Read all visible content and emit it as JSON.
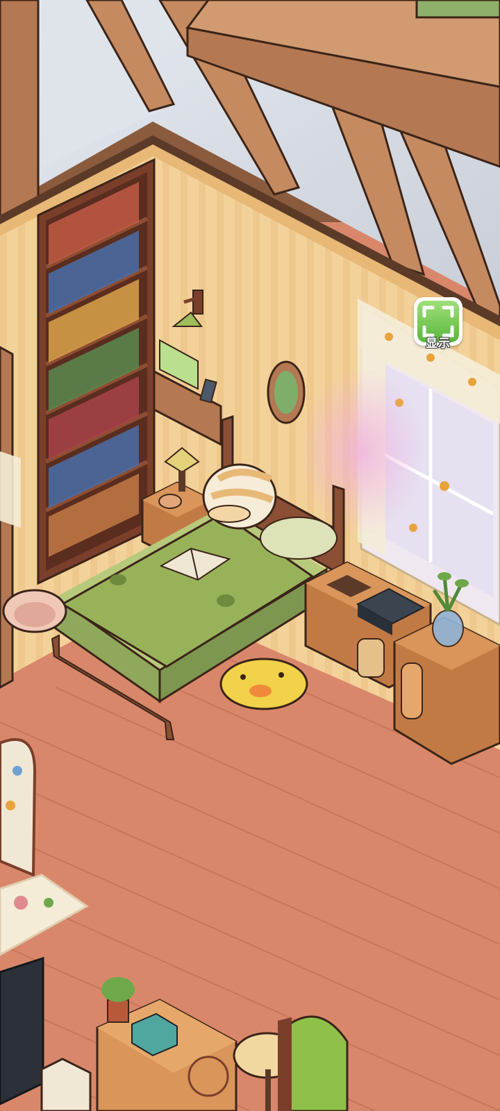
{
  "scene": {
    "type": "isometric-bedroom",
    "colors": {
      "wall": "#f3d29a",
      "floor": "#d9876b",
      "beam": "#c58a60",
      "bedding": "#98b25a",
      "accent_button": "#6fc94b"
    }
  },
  "display_button": {
    "label": "显示",
    "icon": "fullscreen-frame-icon"
  }
}
